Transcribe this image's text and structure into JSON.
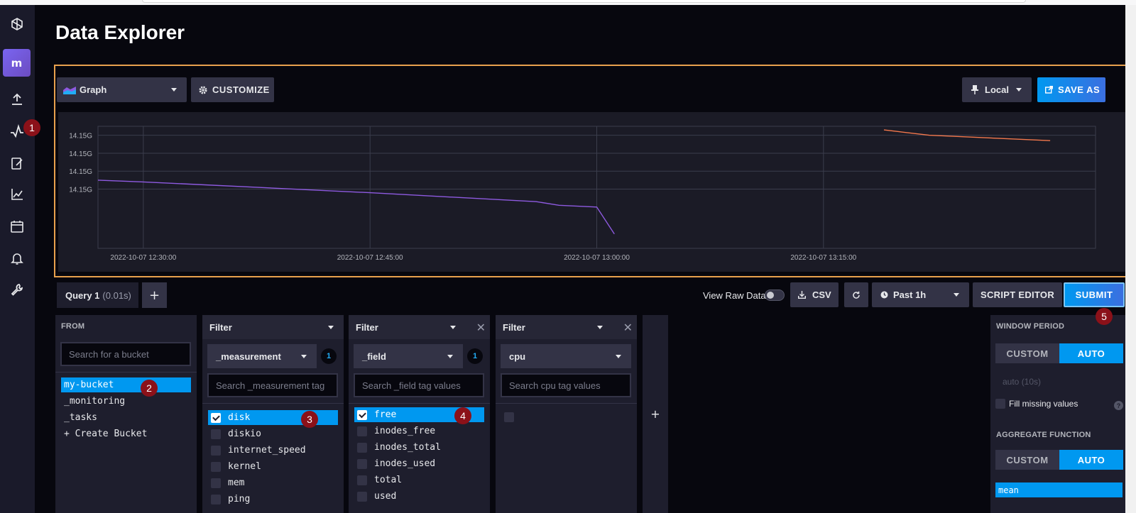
{
  "page": {
    "title": "Data Explorer"
  },
  "sidebar": {
    "avatar_letter": "m",
    "icons": [
      "logo-icon",
      "upload-icon",
      "data-explorer-icon",
      "notebook-icon",
      "dashboard-icon",
      "tasks-icon",
      "alerts-icon",
      "settings-icon"
    ]
  },
  "markers": [
    "1",
    "2",
    "3",
    "4",
    "5"
  ],
  "graph_toolbar": {
    "vis_type": "Graph",
    "customize": "CUSTOMIZE",
    "timezone": "Local",
    "save_as": "SAVE AS"
  },
  "chart_data": {
    "type": "line",
    "y_tick_labels": [
      "14.15G",
      "14.15G",
      "14.15G",
      "14.15G"
    ],
    "x_tick_labels": [
      "2022-10-07 12:30:00",
      "2022-10-07 12:45:00",
      "2022-10-07 13:00:00",
      "2022-10-07 13:15:00"
    ],
    "series": [
      {
        "color": "#8e5ae0",
        "points": [
          [
            "12:27:00",
            14.152
          ],
          [
            "12:30:00",
            14.1519
          ],
          [
            "12:45:00",
            14.1513
          ],
          [
            "12:56:00",
            14.1508
          ],
          [
            "12:57:30",
            14.1506
          ],
          [
            "13:00:00",
            14.1505
          ],
          [
            "13:01:10",
            14.149
          ]
        ]
      },
      {
        "color": "#f4784c",
        "points": [
          [
            "13:19:00",
            14.1548
          ],
          [
            "13:20:00",
            14.1547
          ],
          [
            "13:22:00",
            14.1545
          ],
          [
            "13:30:00",
            14.1542
          ]
        ]
      }
    ],
    "grid": true
  },
  "query_bar": {
    "tab_label": "Query 1",
    "tab_time": "(0.01s)",
    "add": "+",
    "view_raw": "View Raw Data",
    "csv": "CSV",
    "time_range": "Past 1h",
    "script_editor": "SCRIPT EDITOR",
    "submit": "SUBMIT"
  },
  "from_panel": {
    "label": "FROM",
    "search_placeholder": "Search for a bucket",
    "buckets": [
      "my-bucket",
      "_monitoring",
      "_tasks",
      "+ Create Bucket"
    ]
  },
  "filters": [
    {
      "title": "Filter",
      "key": "_measurement",
      "count": "1",
      "search_placeholder": "Search _measurement tag",
      "items": [
        "disk",
        "diskio",
        "internet_speed",
        "kernel",
        "mem",
        "ping"
      ]
    },
    {
      "title": "Filter",
      "key": "_field",
      "count": "1",
      "search_placeholder": "Search _field tag values",
      "items": [
        "free",
        "inodes_free",
        "inodes_total",
        "inodes_used",
        "total",
        "used"
      ]
    },
    {
      "title": "Filter",
      "key": "cpu",
      "search_placeholder": "Search cpu tag values"
    }
  ],
  "add_filter": "+",
  "aggregate_panel": {
    "window_label": "WINDOW PERIOD",
    "custom": "CUSTOM",
    "auto": "AUTO",
    "auto_value": "auto (10s)",
    "fill_missing": "Fill missing values",
    "help": "?",
    "aggregate_label": "AGGREGATE FUNCTION",
    "functions": [
      "mean"
    ]
  }
}
